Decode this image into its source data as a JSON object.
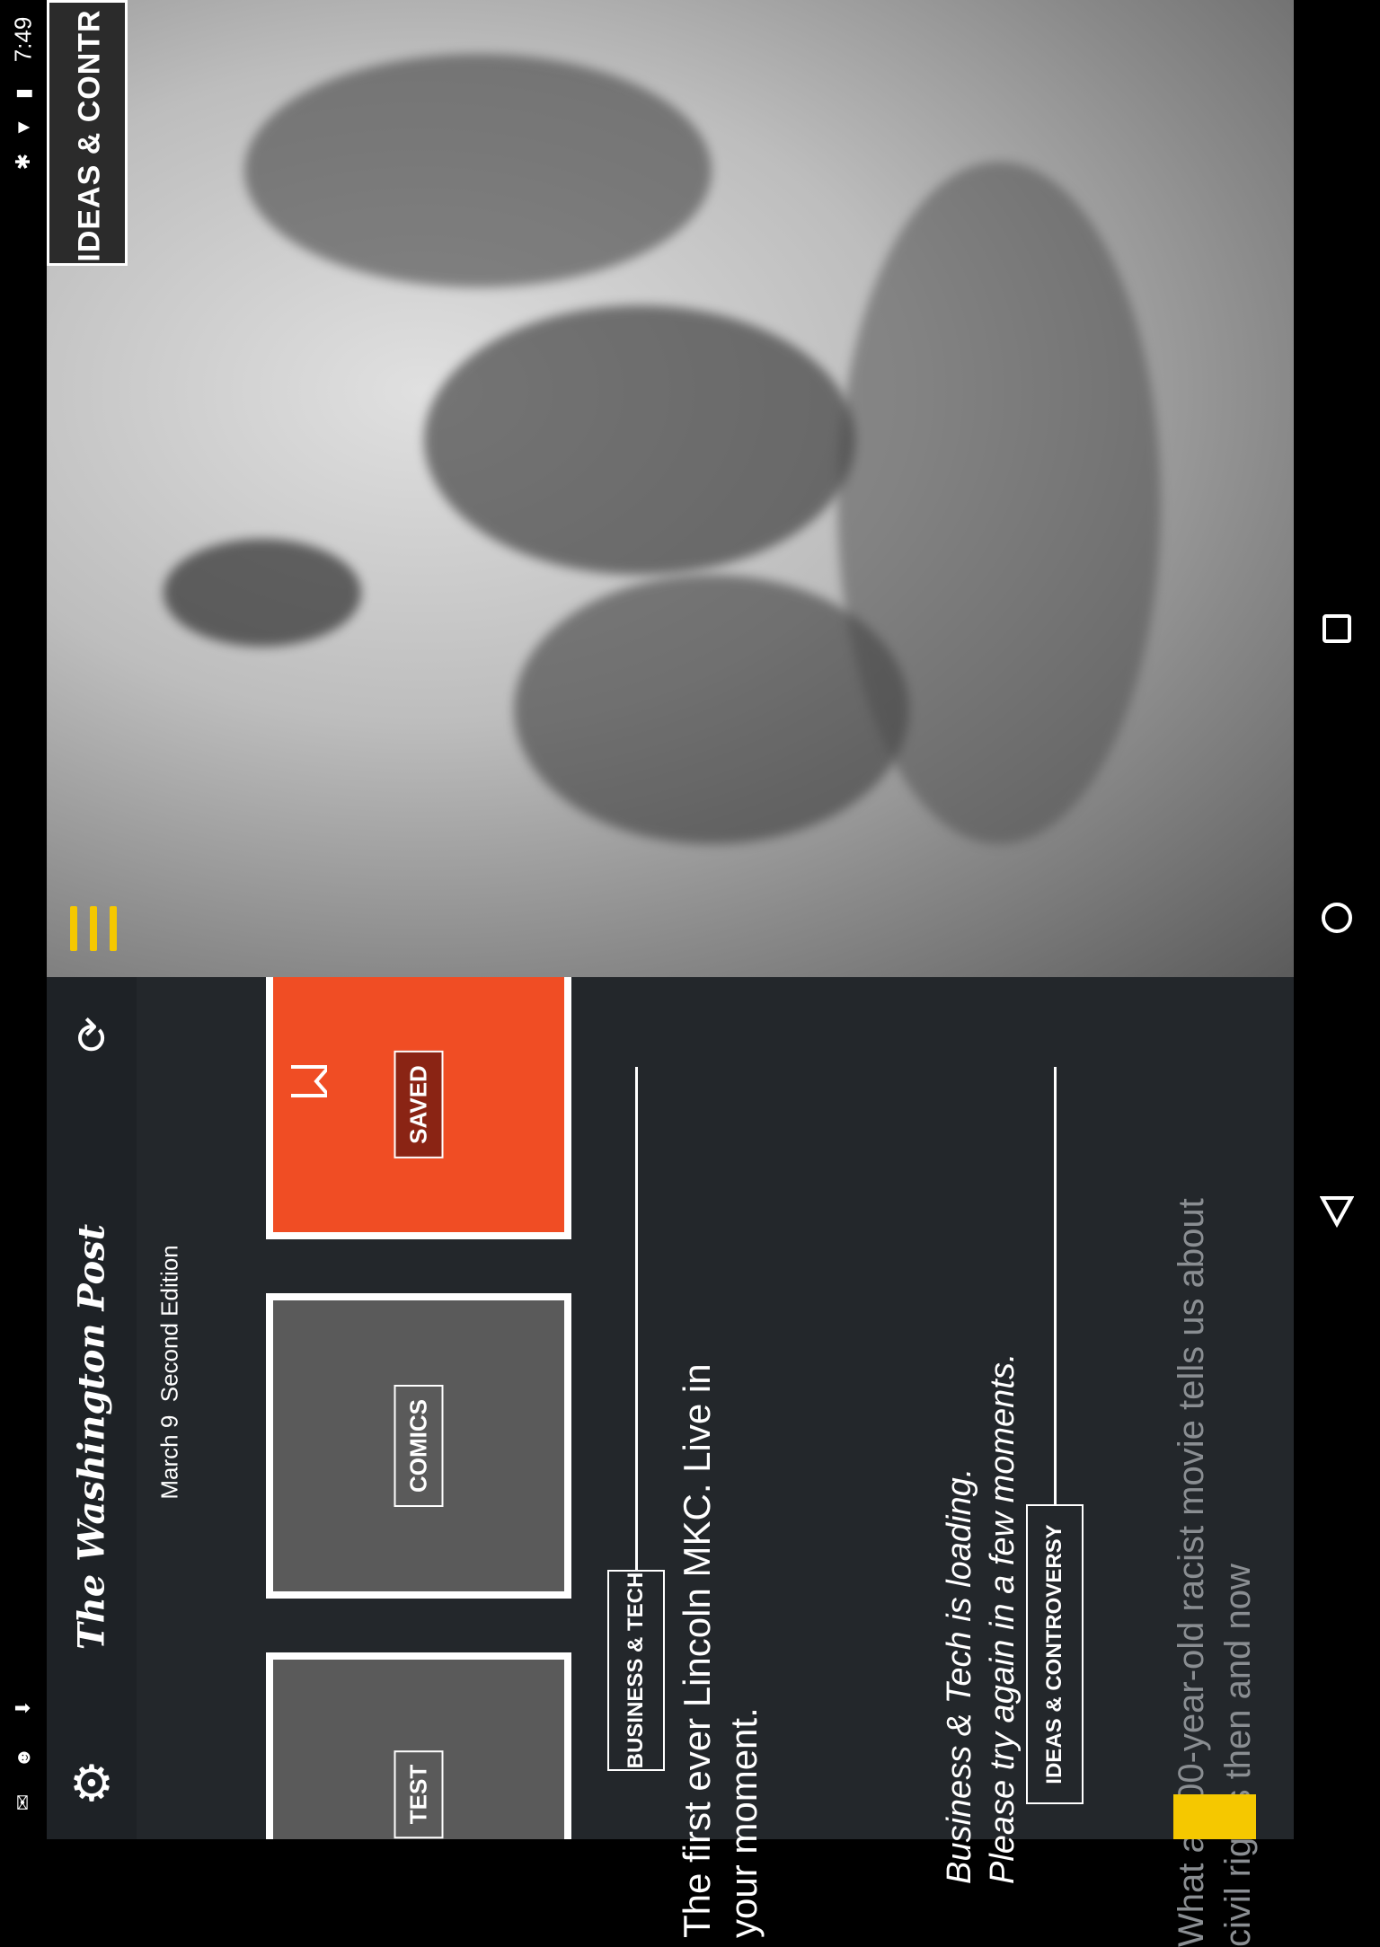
{
  "status_bar": {
    "time": "7:49",
    "icons": [
      "bluetooth-icon",
      "wifi-icon",
      "battery-icon",
      "mail-icon",
      "android-icon",
      "download-icon"
    ]
  },
  "hero": {
    "section_tag": "IDEAS & CONTR",
    "menu_icon": "menu-icon"
  },
  "app": {
    "logo": "The Washington Post",
    "date": "March 9",
    "edition": "Second Edition",
    "refresh_icon": "refresh-icon",
    "settings_icon": "gear-icon"
  },
  "tiles": [
    {
      "label": "SAVED"
    },
    {
      "label": "COMICS"
    },
    {
      "label": "TEST"
    }
  ],
  "feed": {
    "headline": "The first ever Lincoln MKC. Live in your moment.",
    "section_1": "BUSINESS & TECH",
    "loading_line1": "Business & Tech is loading.",
    "loading_line2": "Please try again in a few moments.",
    "section_2": "IDEAS & CONTROVERSY",
    "dim_headline": "What a 100-year-old racist movie tells us about civil rights then and now"
  },
  "nav": {
    "back": "back-icon",
    "home": "home-icon",
    "recents": "recents-icon"
  },
  "colors": {
    "accent_yellow": "#f5c800",
    "saved_orange": "#f04d24",
    "panel_dark": "#23272b",
    "tile_gray": "#5a5a5a"
  }
}
